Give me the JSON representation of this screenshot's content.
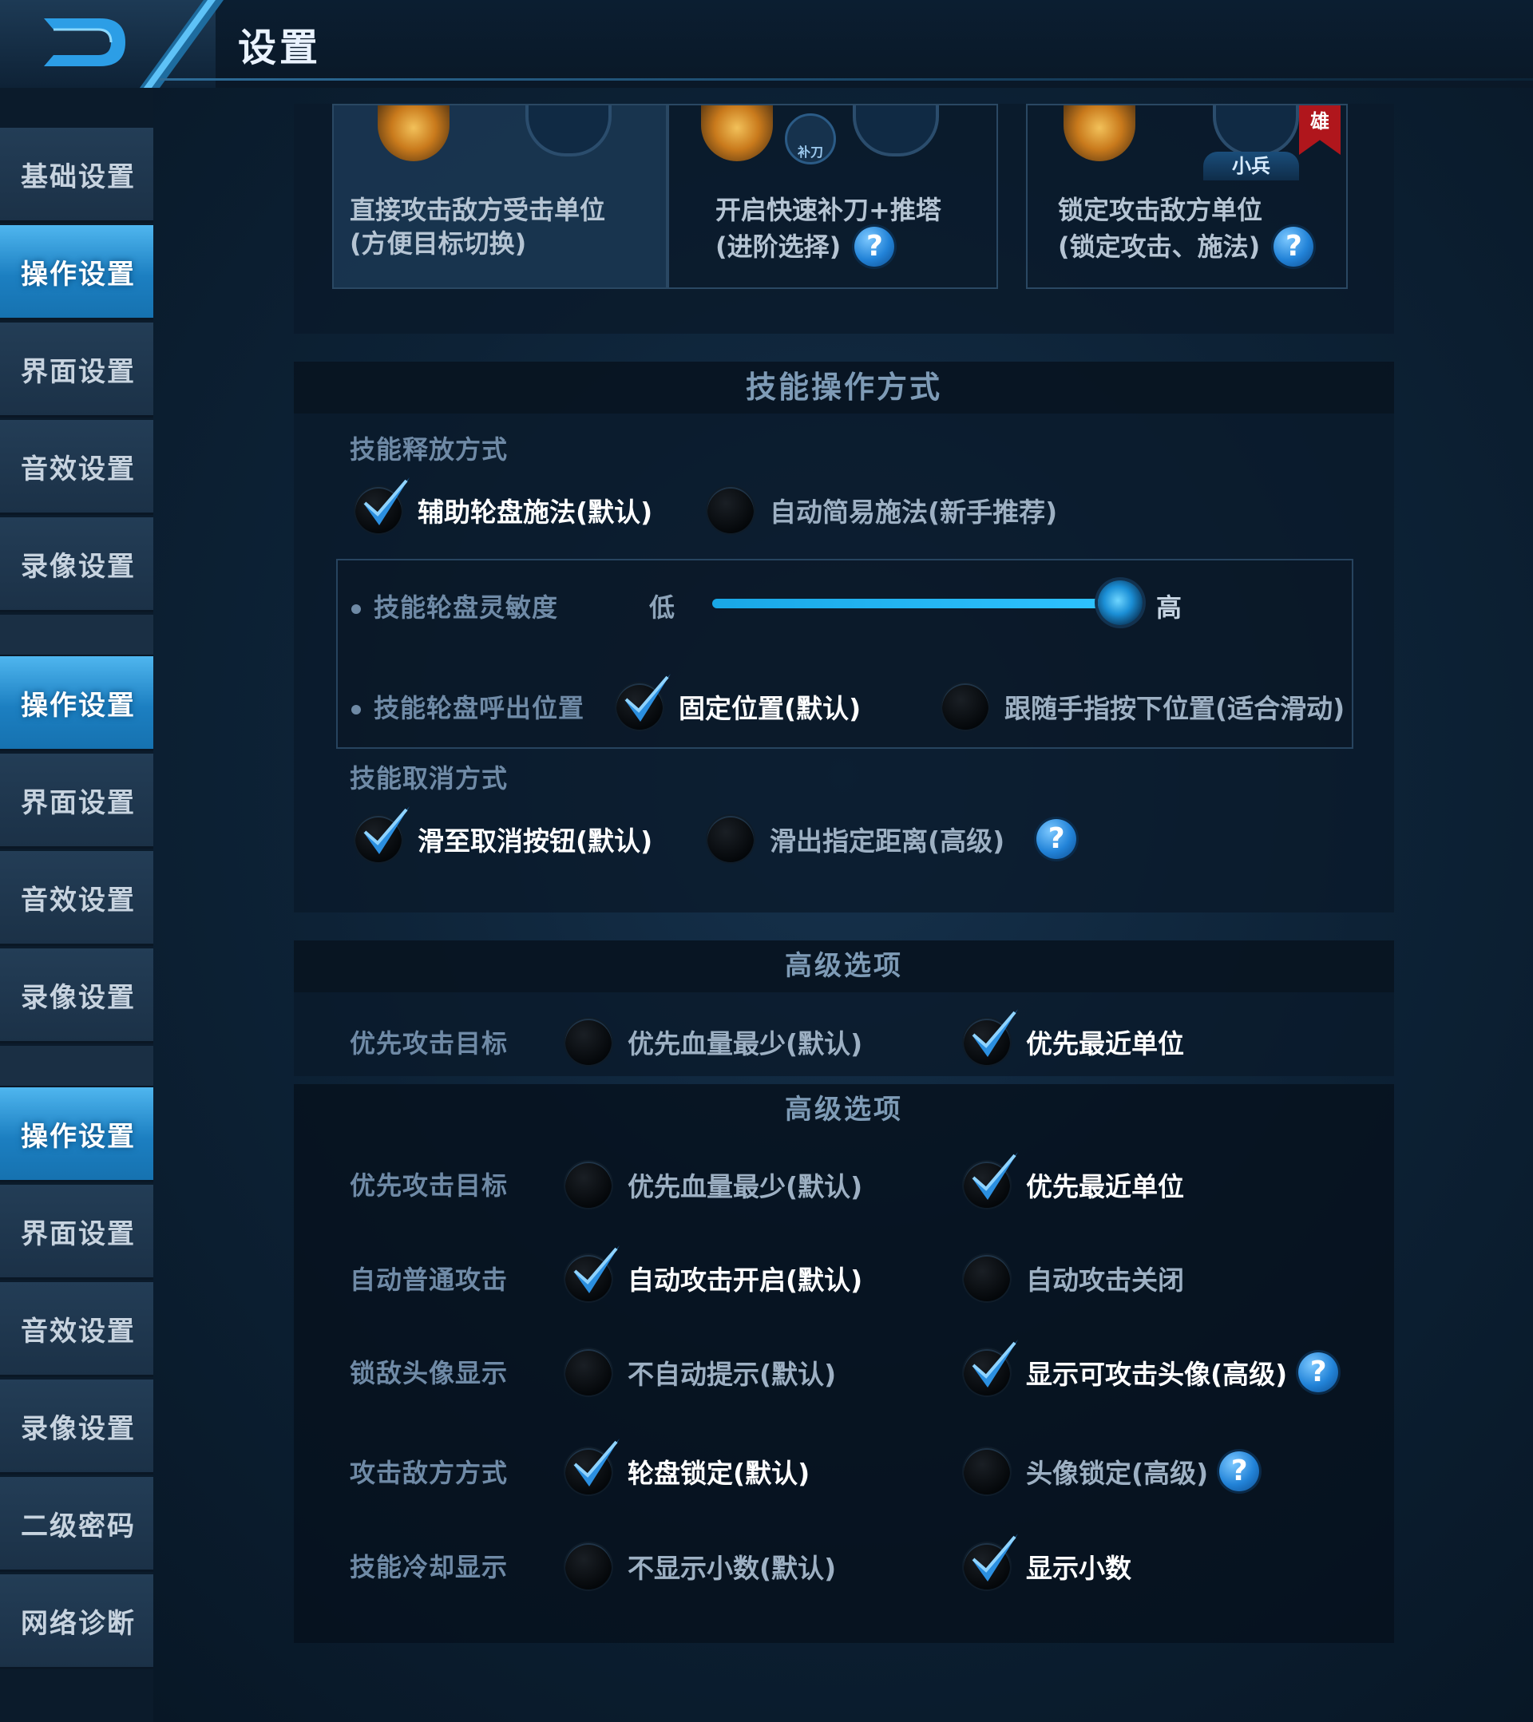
{
  "header": {
    "title": "设置"
  },
  "sidebar": {
    "items": [
      {
        "label": "基础设置",
        "active": false
      },
      {
        "label": "操作设置",
        "active": true
      },
      {
        "label": "界面设置",
        "active": false
      },
      {
        "label": "音效设置",
        "active": false
      },
      {
        "label": "录像设置",
        "active": false
      },
      {
        "label": "操作设置",
        "active": true
      },
      {
        "label": "界面设置",
        "active": false
      },
      {
        "label": "音效设置",
        "active": false
      },
      {
        "label": "录像设置",
        "active": false
      },
      {
        "label": "操作设置",
        "active": true
      },
      {
        "label": "界面设置",
        "active": false
      },
      {
        "label": "音效设置",
        "active": false
      },
      {
        "label": "录像设置",
        "active": false
      },
      {
        "label": "二级密码",
        "active": false
      },
      {
        "label": "网络诊断",
        "active": false
      }
    ]
  },
  "targeting_cards": [
    {
      "line1": "直接攻击敌方受击单位",
      "line2": "(方便目标切换)",
      "selected": true
    },
    {
      "line1": "开启快速补刀+推塔",
      "line2": "(进阶选择)",
      "help": "?",
      "badge": "补刀"
    },
    {
      "line1": "锁定攻击敌方单位",
      "line2": "(锁定攻击、施法)",
      "help": "?",
      "tag_minion": "小兵",
      "tag_hero": "雄"
    }
  ],
  "skill_section": {
    "title": "技能操作方式",
    "release_label": "技能释放方式",
    "release_opt1": "辅助轮盘施法(默认)",
    "release_opt2": "自动简易施法(新手推荐)",
    "sensitivity_label": "技能轮盘灵敏度",
    "sensitivity_low": "低",
    "sensitivity_high": "高",
    "sensitivity_value": 0.92,
    "position_label": "技能轮盘呼出位置",
    "position_opt1": "固定位置(默认)",
    "position_opt2": "跟随手指按下位置(适合滑动)",
    "cancel_label": "技能取消方式",
    "cancel_opt1": "滑至取消按钮(默认)",
    "cancel_opt2": "滑出指定距离(高级)",
    "help": "?"
  },
  "advanced_1": {
    "title": "高级选项",
    "rows": [
      {
        "label": "优先攻击目标",
        "opt1": "优先血量最少(默认)",
        "opt2": "优先最近单位",
        "selected": 2
      }
    ]
  },
  "advanced_2": {
    "title": "高级选项",
    "rows": [
      {
        "label": "优先攻击目标",
        "opt1": "优先血量最少(默认)",
        "opt2": "优先最近单位",
        "selected": 2
      },
      {
        "label": "自动普通攻击",
        "opt1": "自动攻击开启(默认)",
        "opt2": "自动攻击关闭",
        "selected": 1
      },
      {
        "label": "锁敌头像显示",
        "opt1": "不自动提示(默认)",
        "opt2": "显示可攻击头像(高级)",
        "selected": 2,
        "help2": "?"
      },
      {
        "label": "攻击敌方方式",
        "opt1": "轮盘锁定(默认)",
        "opt2": "头像锁定(高级)",
        "selected": 1,
        "help2": "?"
      },
      {
        "label": "技能冷却显示",
        "opt1": "不显示小数(默认)",
        "opt2": "显示小数",
        "selected": 2
      }
    ]
  },
  "colors": {
    "accent": "#1fa7ea",
    "check": "#2b8fe0",
    "background": "#0d2236"
  }
}
